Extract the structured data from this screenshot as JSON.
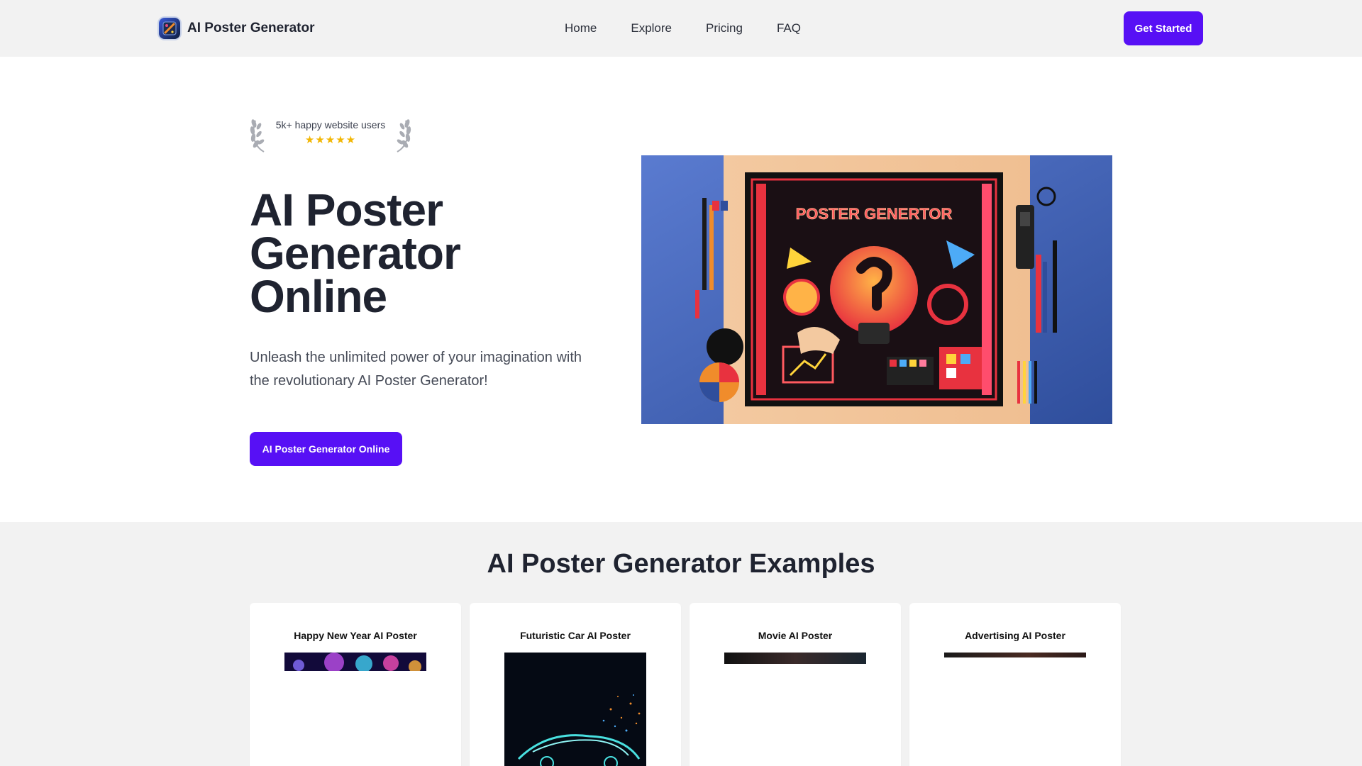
{
  "navbar": {
    "brand_name": "AI Poster Generator",
    "brand_icon": "app-logo-icon",
    "links": [
      "Home",
      "Explore",
      "Pricing",
      "FAQ"
    ],
    "cta_label": "Get Started"
  },
  "hero": {
    "badge_text": "5k+ happy website users",
    "rating": 5,
    "stars_text": "★★★★★",
    "title": "AI Poster Generator Online",
    "subtitle": "Unleash the unlimited power of your imagination with the revolutionary AI Poster Generator!",
    "cta_label": "AI Poster Generator Online",
    "image_text": "POSTER GENERTOR"
  },
  "examples": {
    "title": "AI Poster Generator Examples",
    "cards": [
      {
        "title": "Happy New Year AI Poster"
      },
      {
        "title": "Futuristic Car AI Poster"
      },
      {
        "title": "Movie AI Poster"
      },
      {
        "title": "Advertising AI Poster"
      }
    ]
  },
  "colors": {
    "accent": "#5710f5",
    "star": "#f2b705",
    "text": "#1f2330",
    "nav_bg": "#f2f2f2"
  }
}
